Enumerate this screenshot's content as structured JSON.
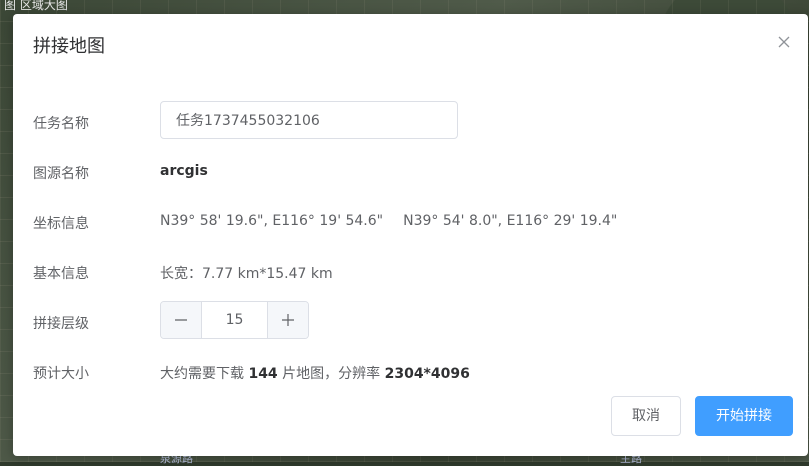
{
  "map": {
    "top_label": "图 区域大图",
    "bottom_label_left": "泉源路",
    "bottom_label_right": "主路"
  },
  "dialog": {
    "title": "拼接地图",
    "close_icon": "close-icon",
    "fields": {
      "task_name_label": "任务名称",
      "task_name_value": "任务1737455032106",
      "source_label": "图源名称",
      "source_value": "arcgis",
      "coord_label": "坐标信息",
      "coord_1": "N39° 58' 19.6\", E116° 19' 54.6\"",
      "coord_2": "N39° 54' 8.0\", E116° 29' 19.4\"",
      "basic_label": "基本信息",
      "basic_value": "长宽：7.77 km*15.47 km",
      "level_label": "拼接层级",
      "level_value": "15",
      "size_label": "预计大小",
      "size_prefix": "大约需要下载",
      "size_count": "144",
      "size_middle": "片地图，分辨率",
      "size_resolution": "2304*4096"
    },
    "buttons": {
      "cancel": "取消",
      "confirm": "开始拼接"
    },
    "colors": {
      "primary": "#409eff",
      "border": "#dcdfe6",
      "label": "#606266"
    }
  }
}
